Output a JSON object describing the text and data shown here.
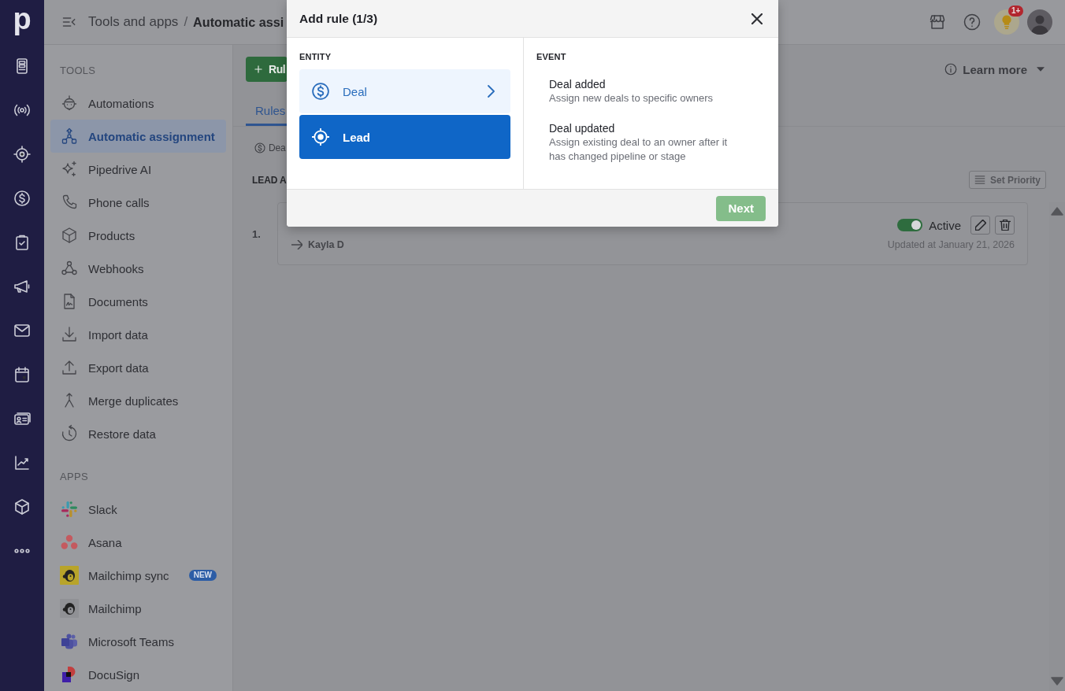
{
  "nav_rail": {
    "logo": "p"
  },
  "top_bar": {
    "breadcrumb": [
      "Tools and apps",
      "Automatic assi"
    ],
    "separator": "/",
    "notification_badge": "1+"
  },
  "sidebar": {
    "sections": [
      {
        "title": "TOOLS",
        "items": [
          {
            "label": "Automations",
            "selected": false
          },
          {
            "label": "Automatic assignment",
            "selected": true
          },
          {
            "label": "Pipedrive AI",
            "selected": false
          },
          {
            "label": "Phone calls",
            "selected": false
          },
          {
            "label": "Products",
            "selected": false
          },
          {
            "label": "Webhooks",
            "selected": false
          },
          {
            "label": "Documents",
            "selected": false
          },
          {
            "label": "Import data",
            "selected": false
          },
          {
            "label": "Export data",
            "selected": false
          },
          {
            "label": "Merge duplicates",
            "selected": false
          },
          {
            "label": "Restore data",
            "selected": false
          }
        ]
      },
      {
        "title": "APPS",
        "items": [
          {
            "label": "Slack",
            "selected": false
          },
          {
            "label": "Asana",
            "selected": false
          },
          {
            "label": "Mailchimp sync",
            "selected": false,
            "badge": "NEW"
          },
          {
            "label": "Mailchimp",
            "selected": false
          },
          {
            "label": "Microsoft Teams",
            "selected": false
          },
          {
            "label": "DocuSign",
            "selected": false
          }
        ]
      }
    ]
  },
  "main": {
    "add_button": "Rul",
    "learn_more": "Learn more",
    "tabs": [
      {
        "label": "Rules",
        "selected": true
      }
    ],
    "filter": "Dea",
    "section_title": "LEAD A",
    "set_priority": "Set Priority",
    "rules": [
      {
        "number": "1.",
        "assignee": "Kayla D",
        "active": true,
        "status": "Active",
        "updated": "Updated at January 21, 2026"
      }
    ]
  },
  "modal": {
    "title": "Add rule (1/3)",
    "entity_heading": "ENTITY",
    "entities": [
      {
        "label": "Deal",
        "selected": true,
        "hovered": false
      },
      {
        "label": "Lead",
        "selected": false,
        "hovered": true
      }
    ],
    "event_heading": "EVENT",
    "events": [
      {
        "title": "Deal added",
        "description": "Assign new deals to specific owners",
        "selected": false
      },
      {
        "title": "Deal updated",
        "description": "Assign existing deal to an owner after it has changed pipeline or stage",
        "selected": false
      }
    ],
    "next_button": {
      "label": "Next",
      "disabled": true
    }
  }
}
